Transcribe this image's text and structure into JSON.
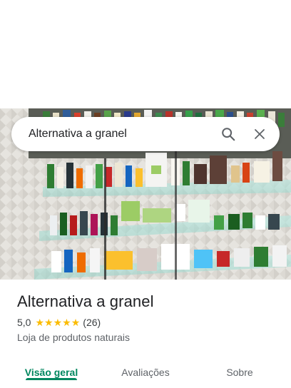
{
  "search": {
    "value": "Alternativa a granel",
    "search_icon": "search-icon",
    "close_icon": "close-icon"
  },
  "place": {
    "name": "Alternativa a granel",
    "rating": "5,0",
    "stars": 5,
    "reviews": "(26)",
    "category": "Loja de produtos naturais"
  },
  "tabs": [
    {
      "label": "Visão geral",
      "active": true
    },
    {
      "label": "Avaliações",
      "active": false
    },
    {
      "label": "Sobre",
      "active": false
    }
  ],
  "colors": {
    "accent": "#01875f",
    "star": "#fbbc04"
  }
}
